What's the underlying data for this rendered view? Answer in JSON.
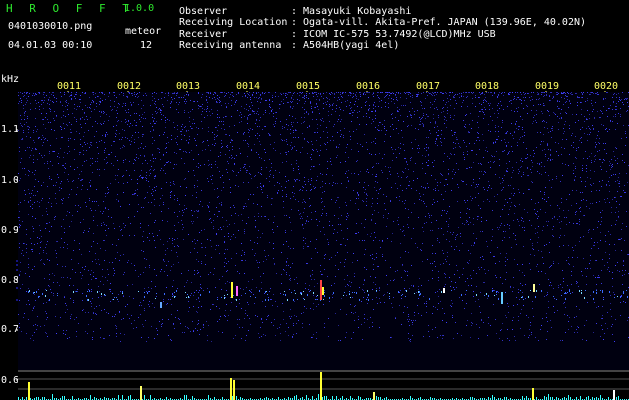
{
  "app": {
    "name": "H R O F F T",
    "version": "1.0.0",
    "filename": "0401030010.png",
    "datetime": "04.01.03 00:10",
    "meteor_label": "meteor",
    "meteor_count": "12"
  },
  "info": {
    "rows": [
      {
        "label": "Observer",
        "value": ": Masayuki Kobayashi"
      },
      {
        "label": "Receiving Location",
        "value": ": Ogata-vill. Akita-Pref. JAPAN (139.96E, 40.02N)"
      },
      {
        "label": "Receiver",
        "value": ": ICOM IC-575 53.7492(@LCD)MHz USB"
      },
      {
        "label": "Receiving antenna",
        "value": ": A504HB(yagi 4el)"
      }
    ]
  },
  "axis": {
    "unit": "kHz",
    "y_labels": [
      "1.1",
      "1.0",
      "0.9",
      "0.8",
      "0.7",
      "0.6"
    ],
    "time_labels": [
      "0011",
      "0012",
      "0013",
      "0014",
      "0015",
      "0016",
      "0017",
      "0018",
      "0019",
      "0020"
    ]
  },
  "colors": {
    "background": "#000000",
    "title_green": "#2ee82e",
    "tick_yellow": "#ffff66",
    "noise_blue": "#2a2aff",
    "echo_cyan": "#33ffff",
    "meteor_yellow": "#ffff33"
  }
}
